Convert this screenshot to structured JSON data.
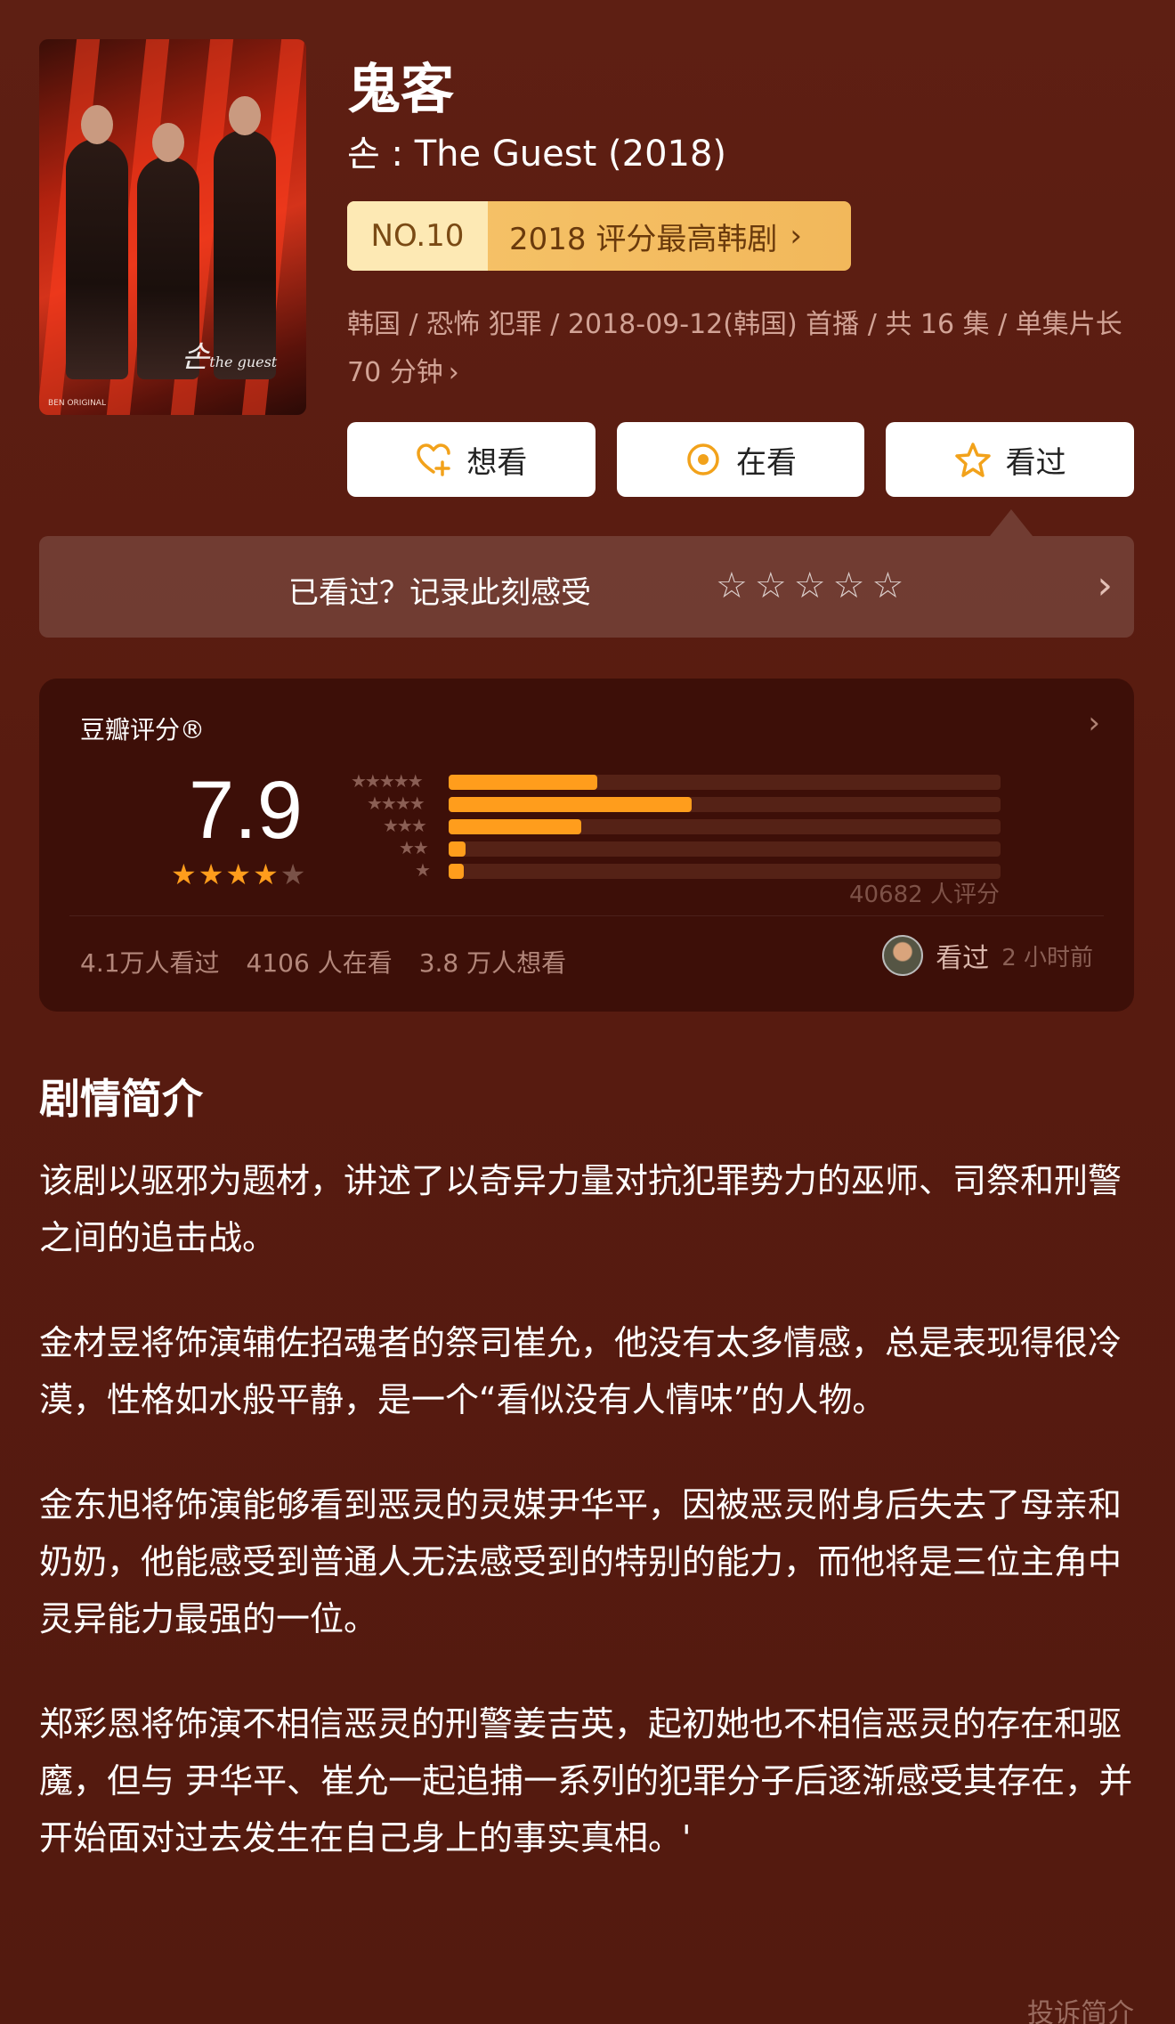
{
  "header": {
    "title": "鬼客",
    "subtitle": "손 : The Guest (2018)",
    "poster_script": "손",
    "poster_script_small": "the guest",
    "poster_credits": "BEN ORIGINAL",
    "rank_no": "NO.10",
    "rank_text": "2018 评分最高韩剧",
    "rank_chev": "›",
    "meta": "韩国 / 恐怖 犯罪 / 2018-09-12(韩国) 首播 / 共 16 集 / 单集片长 70 分钟",
    "meta_chev": "›"
  },
  "actions": {
    "want": "想看",
    "watching": "在看",
    "watched": "看过"
  },
  "record": {
    "prompt": "已看过？记录此刻感受",
    "chev": "›"
  },
  "rating": {
    "label": "豆瓣评分®",
    "chev": "›",
    "score": "7.9",
    "stars_filled": 4,
    "stars_total": 5,
    "count": "40682 人评分",
    "distribution": [
      {
        "stars": 5,
        "fraction": 0.27
      },
      {
        "stars": 4,
        "fraction": 0.44
      },
      {
        "stars": 3,
        "fraction": 0.24
      },
      {
        "stars": 2,
        "fraction": 0.03
      },
      {
        "stars": 1,
        "fraction": 0.025
      }
    ],
    "stats": [
      "4.1万人看过",
      "4106 人在看",
      "3.8 万人想看"
    ],
    "recent_label": "看过",
    "recent_ago": "2 小时前"
  },
  "synopsis": {
    "title": "剧情简介",
    "paragraphs": [
      "该剧以驱邪为题材，讲述了以奇异力量对抗犯罪势力的巫师、司祭和刑警之间的追击战。",
      "金材昱将饰演辅佐招魂者的祭司崔允，他没有太多情感，总是表现得很冷漠，性格如水般平静，是一个“看似没有人情味”的人物。",
      "金东旭将饰演能够看到恶灵的灵媒尹华平，因被恶灵附身后失去了母亲和奶奶，他能感受到普通人无法感受到的特别的能力，而他将是三位主角中灵异能力最强的一位。",
      "郑彩恩将饰演不相信恶灵的刑警姜吉英，起初她也不相信恶灵的存在和驱魔，但与 尹华平、崔允一起追捕一系列的犯罪分子后逐渐感受其存在，并开始面对过去发生在自己身上的事实真相。'"
    ],
    "report": "投诉简介"
  },
  "colors": {
    "background": "#5a1d12",
    "card": "#3d0f08",
    "accent_star": "#ff9d1c",
    "badge": "#f6c46a"
  }
}
